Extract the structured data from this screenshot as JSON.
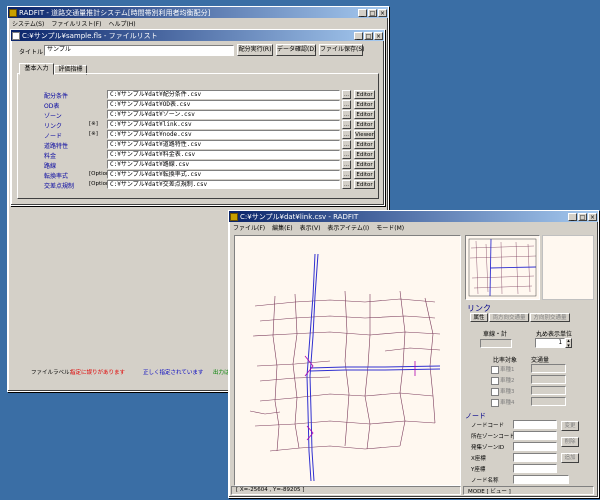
{
  "main_window": {
    "title": "RADFIT - 道路交通量推計システム[時間帯別利用者均衡配分]",
    "menu": [
      "システム(S)",
      "ファイルリスト(F)",
      "ヘルプ(H)"
    ]
  },
  "filelist_window": {
    "title": "C:¥サンプル¥sample.fls - ファイルリスト",
    "title_label": "タイトル",
    "title_value": "サンプル",
    "buttons": {
      "run": "配分実行(R)",
      "check": "データ確認(D)",
      "save": "ファイル保存(S)"
    },
    "tabs": [
      "基本入力",
      "評価指標"
    ],
    "rows": [
      {
        "label": "配分条件",
        "tag": "",
        "path": "C:¥サンプル¥dat¥配分条件.csv",
        "button": "Editor"
      },
      {
        "label": "OD表",
        "tag": "",
        "path": "C:¥サンプル¥dat¥OD表.csv",
        "button": "Editor"
      },
      {
        "label": "ゾーン",
        "tag": "",
        "path": "C:¥サンプル¥dat¥ゾーン.csv",
        "button": "Editor"
      },
      {
        "label": "リンク",
        "tag": "[※]",
        "path": "C:¥サンプル¥dat¥link.csv",
        "button": "Editor"
      },
      {
        "label": "ノード",
        "tag": "[※]",
        "path": "C:¥サンプル¥dat¥node.csv",
        "button": "Viewer"
      },
      {
        "label": "道路特性",
        "tag": "",
        "path": "C:¥サンプル¥dat¥道路特性.csv",
        "button": "Editor"
      },
      {
        "label": "料金",
        "tag": "",
        "path": "C:¥サンプル¥dat¥料金表.csv",
        "button": "Editor"
      },
      {
        "label": "路線",
        "tag": "",
        "path": "C:¥サンプル¥dat¥路線.csv",
        "button": "Editor"
      },
      {
        "label": "転換率式",
        "tag": "[Option]",
        "path": "C:¥サンプル¥dat¥転換率式.csv",
        "button": "Editor"
      },
      {
        "label": "交差点規制",
        "tag": "[Option]",
        "path": "C:¥サンプル¥dat¥交差点規制.csv",
        "button": "Editor"
      }
    ],
    "status_label": "ファイルラベル：",
    "status_error": "指定に誤りがあります",
    "status_ok": "正しく指定されています",
    "status_note": "出力は上書き"
  },
  "link_window": {
    "title": "C:¥サンプル¥dat¥link.csv - RADFIT",
    "menu": [
      "ファイル(F)",
      "編集(E)",
      "表示(V)",
      "表示アイテム(I)",
      "モード(M)"
    ],
    "statusbar_coords": "[ X=-25604 , Y=-89205 ]",
    "statusbar_mode": "MODE [ ビュー ]",
    "link_section": "リンク",
    "link_tabs": [
      "属性",
      "両方向交通量",
      "方向別交通量"
    ],
    "lane_label": "車線・計",
    "round_label": "丸め表示単位",
    "round_value": "1",
    "ratio_label": "比率対象",
    "volume_label": "交通量",
    "vehicle_types": [
      "車種1",
      "車種2",
      "車種3",
      "車種4"
    ],
    "node_section": "ノード",
    "node_fields": [
      "ノードコード",
      "所在ゾーンコード",
      "発集ゾーンID",
      "X座標",
      "Y座標",
      "ノード名称"
    ],
    "node_buttons": [
      "変更",
      "削除",
      "追加"
    ]
  },
  "colors": {
    "title_active": "#0a246a",
    "link_blue": "#3030d0",
    "link_magenta": "#b000b0",
    "map_bg": "#fff8f0"
  }
}
